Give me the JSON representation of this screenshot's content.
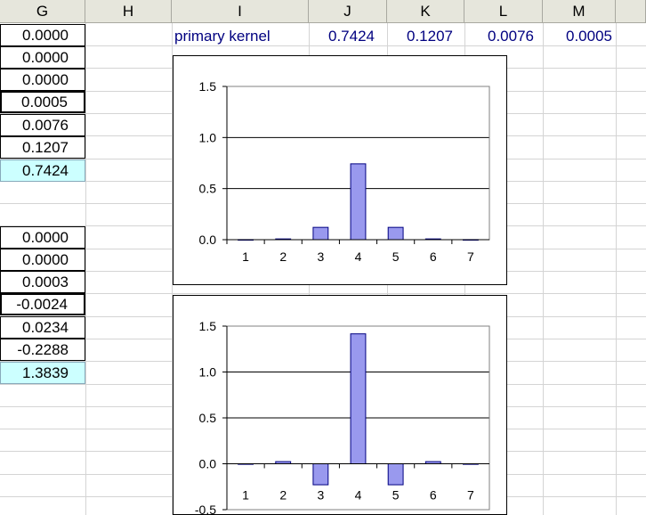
{
  "columns": [
    {
      "letter": "G"
    },
    {
      "letter": "H"
    },
    {
      "letter": "I"
    },
    {
      "letter": "J"
    },
    {
      "letter": "K"
    },
    {
      "letter": "L"
    },
    {
      "letter": "M"
    }
  ],
  "row_top": {
    "label": "primary kernel",
    "j": "0.7424",
    "k": "0.1207",
    "l": "0.0076",
    "m": "0.0005"
  },
  "g_upper": [
    "0.0000",
    "0.0000",
    "0.0000",
    "0.0005",
    "0.0076",
    "0.1207",
    "0.7424"
  ],
  "g_lower": [
    "0.0000",
    "0.0000",
    "0.0003",
    "-0.0024",
    "0.0234",
    "-0.2288",
    "1.3839"
  ],
  "colors": {
    "bar_fill": "#9999ee",
    "bar_stroke": "#000080",
    "header_bg": "#e6e6dc",
    "highlight": "#ccffff",
    "text_blue": "#000080"
  },
  "chart_data": [
    {
      "type": "bar",
      "categories": [
        "1",
        "2",
        "3",
        "4",
        "5",
        "6",
        "7"
      ],
      "values": [
        0.0005,
        0.0076,
        0.1207,
        0.7424,
        0.1207,
        0.0076,
        0.0005
      ],
      "yticks": [
        "0.0",
        "0.5",
        "1.0",
        "1.5"
      ],
      "ylim": [
        0,
        1.5
      ],
      "grid": true
    },
    {
      "type": "bar",
      "categories": [
        "1",
        "2",
        "3",
        "4",
        "5",
        "6",
        "7"
      ],
      "values": [
        -0.0024,
        0.0234,
        -0.2288,
        1.4157,
        -0.2288,
        0.0234,
        -0.0024
      ],
      "yticks": [
        "-0.5",
        "0.0",
        "0.5",
        "1.0",
        "1.5"
      ],
      "ylim": [
        -0.5,
        1.5
      ],
      "grid": true
    }
  ]
}
